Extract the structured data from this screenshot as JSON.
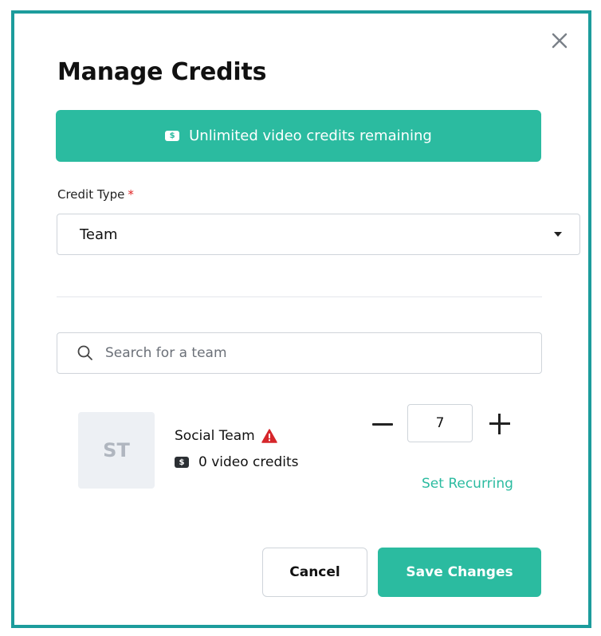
{
  "dialog": {
    "title": "Manage Credits",
    "close_icon": "close-icon"
  },
  "banner": {
    "icon": "money-icon",
    "icon_glyph": "$",
    "text": "Unlimited video credits remaining",
    "color": "#2bbba0"
  },
  "credit_type": {
    "label": "Credit Type",
    "required_mark": "*",
    "selected_value": "Team",
    "icon": "caret-down-icon"
  },
  "search": {
    "placeholder": "Search for a team",
    "value": "",
    "icon": "search-icon"
  },
  "team": {
    "initials": "ST",
    "name": "Social Team",
    "warning_icon": "warning-icon",
    "credits_icon": "money-icon",
    "credits_icon_glyph": "$",
    "credits_text": "0 video credits",
    "quantity": "7",
    "decrement_icon": "minus-icon",
    "increment_icon": "plus-icon",
    "set_recurring_label": "Set Recurring"
  },
  "footer": {
    "cancel_label": "Cancel",
    "save_label": "Save Changes"
  },
  "colors": {
    "accent": "#2bbba0",
    "frame": "#1c9c9c",
    "warning": "#d6262b",
    "required": "#e02424"
  }
}
